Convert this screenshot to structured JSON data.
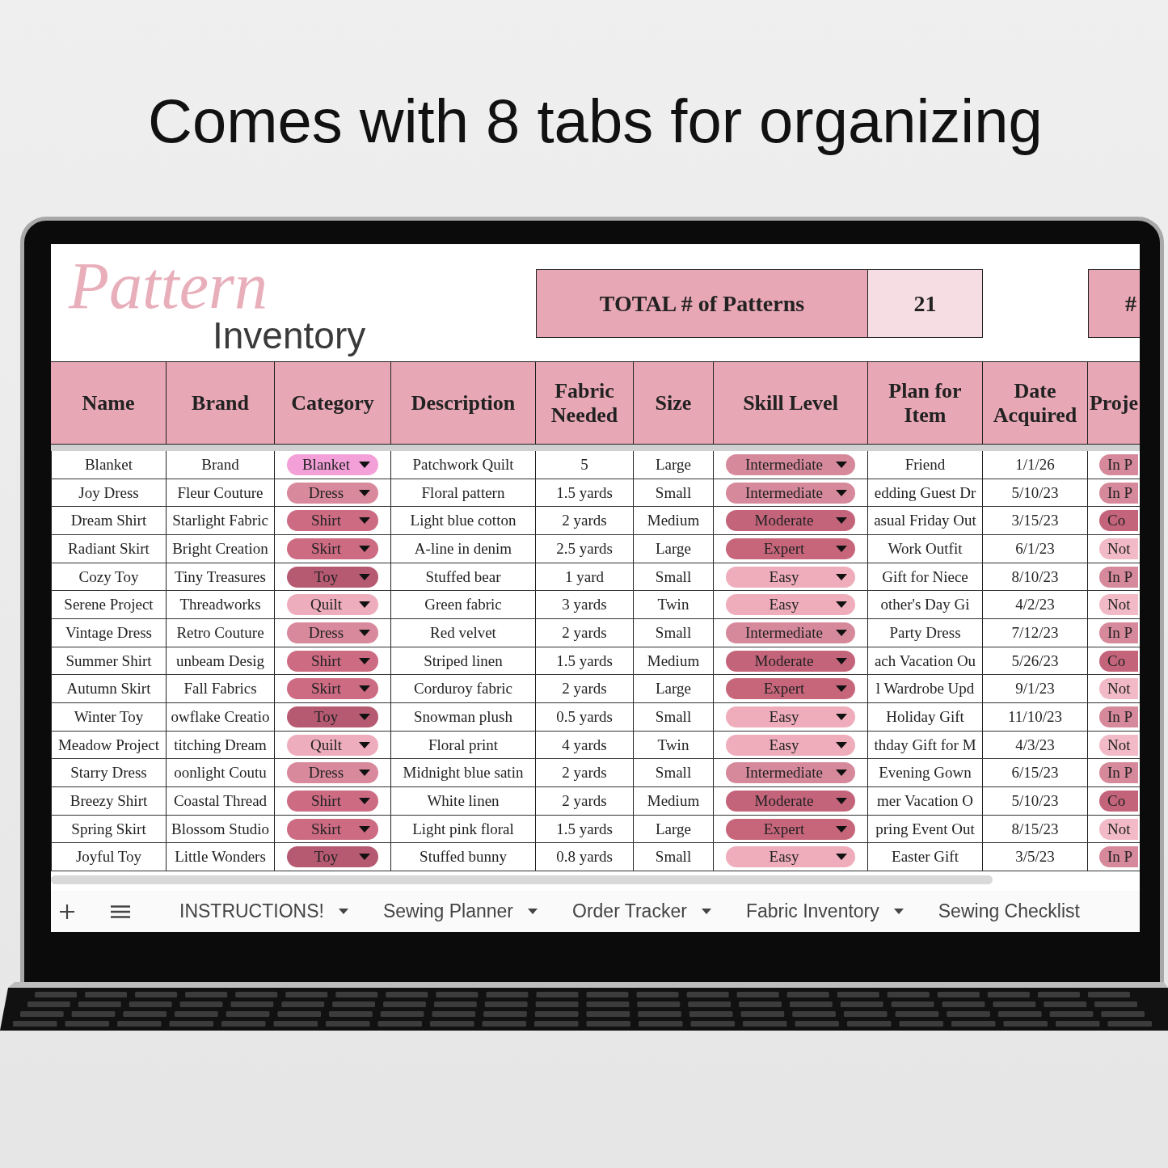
{
  "headline": "Comes with 8 tabs for organizing",
  "sheet": {
    "logo": {
      "script": "Pattern",
      "text": "Inventory"
    },
    "summary": [
      {
        "label": "TOTAL # of Patterns",
        "value": "21"
      },
      {
        "label": "#"
      }
    ],
    "columns": [
      {
        "label": "Name",
        "kind": "text"
      },
      {
        "label": "Brand",
        "kind": "text"
      },
      {
        "label": "Category",
        "kind": "dropdown"
      },
      {
        "label": "Description",
        "kind": "text"
      },
      {
        "label": "Fabric Needed",
        "kind": "text"
      },
      {
        "label": "Size",
        "kind": "text"
      },
      {
        "label": "Skill Level",
        "kind": "dropdown"
      },
      {
        "label": "Plan for Item",
        "kind": "text"
      },
      {
        "label": "Date Acquired",
        "kind": "text"
      },
      {
        "label": "Proje",
        "kind": "pill"
      }
    ],
    "rows": [
      {
        "cells": [
          "Blanket",
          "Brand",
          {
            "label": "Blanket",
            "color": "#f3a0d9"
          },
          "Patchwork Quilt",
          "5",
          "Large",
          {
            "label": "Intermediate",
            "color": "#d6899b"
          },
          "Friend",
          "1/1/26",
          {
            "label": "In P",
            "color": "#d6899b"
          }
        ]
      },
      {
        "cells": [
          "Joy Dress",
          "Fleur Couture",
          {
            "label": "Dress",
            "color": "#d8899b"
          },
          "Floral pattern",
          "1.5 yards",
          "Small",
          {
            "label": "Intermediate",
            "color": "#d6899b"
          },
          "edding Guest Dr",
          "5/10/23",
          {
            "label": "In P",
            "color": "#d6899b"
          }
        ]
      },
      {
        "cells": [
          "Dream Shirt",
          "Starlight Fabric",
          {
            "label": "Shirt",
            "color": "#cc6b82"
          },
          "Light blue cotton",
          "2 yards",
          "Medium",
          {
            "label": "Moderate",
            "color": "#c4647a"
          },
          "asual Friday Out",
          "3/15/23",
          {
            "label": "Co",
            "color": "#c4647a"
          }
        ]
      },
      {
        "cells": [
          "Radiant Skirt",
          "Bright Creation",
          {
            "label": "Skirt",
            "color": "#cc6b82"
          },
          "A-line in denim",
          "2.5 yards",
          "Large",
          {
            "label": "Expert",
            "color": "#c7667b"
          },
          "Work Outfit",
          "6/1/23",
          {
            "label": "Not",
            "color": "#f2bac6"
          }
        ]
      },
      {
        "cells": [
          "Cozy Toy",
          "Tiny Treasures",
          {
            "label": "Toy",
            "color": "#b65a71"
          },
          "Stuffed bear",
          "1 yard",
          "Small",
          {
            "label": "Easy",
            "color": "#efadbb"
          },
          "Gift for Niece",
          "8/10/23",
          {
            "label": "In P",
            "color": "#d6899b"
          }
        ]
      },
      {
        "cells": [
          "Serene Project",
          "Threadworks",
          {
            "label": "Quilt",
            "color": "#eeadbd"
          },
          "Green fabric",
          "3 yards",
          "Twin",
          {
            "label": "Easy",
            "color": "#efadbb"
          },
          "other's Day Gi",
          "4/2/23",
          {
            "label": "Not",
            "color": "#f2bac6"
          }
        ]
      },
      {
        "cells": [
          "Vintage Dress",
          "Retro Couture",
          {
            "label": "Dress",
            "color": "#d8899b"
          },
          "Red velvet",
          "2 yards",
          "Small",
          {
            "label": "Intermediate",
            "color": "#d6899b"
          },
          "Party Dress",
          "7/12/23",
          {
            "label": "In P",
            "color": "#d6899b"
          }
        ]
      },
      {
        "cells": [
          "Summer Shirt",
          "unbeam Desig",
          {
            "label": "Shirt",
            "color": "#cc6b82"
          },
          "Striped linen",
          "1.5 yards",
          "Medium",
          {
            "label": "Moderate",
            "color": "#c4647a"
          },
          "ach Vacation Ou",
          "5/26/23",
          {
            "label": "Co",
            "color": "#c4647a"
          }
        ]
      },
      {
        "cells": [
          "Autumn Skirt",
          "Fall Fabrics",
          {
            "label": "Skirt",
            "color": "#cc6b82"
          },
          "Corduroy fabric",
          "2 yards",
          "Large",
          {
            "label": "Expert",
            "color": "#c7667b"
          },
          "l Wardrobe Upd",
          "9/1/23",
          {
            "label": "Not",
            "color": "#f2bac6"
          }
        ]
      },
      {
        "cells": [
          "Winter Toy",
          "owflake Creatio",
          {
            "label": "Toy",
            "color": "#b65a71"
          },
          "Snowman plush",
          "0.5 yards",
          "Small",
          {
            "label": "Easy",
            "color": "#efadbb"
          },
          "Holiday Gift",
          "11/10/23",
          {
            "label": "In P",
            "color": "#d6899b"
          }
        ]
      },
      {
        "cells": [
          "Meadow Project",
          "titching Dream",
          {
            "label": "Quilt",
            "color": "#eeadbd"
          },
          "Floral print",
          "4 yards",
          "Twin",
          {
            "label": "Easy",
            "color": "#efadbb"
          },
          "thday Gift for M",
          "4/3/23",
          {
            "label": "Not",
            "color": "#f2bac6"
          }
        ]
      },
      {
        "cells": [
          "Starry Dress",
          "oonlight Coutu",
          {
            "label": "Dress",
            "color": "#d8899b"
          },
          "Midnight blue satin",
          "2 yards",
          "Small",
          {
            "label": "Intermediate",
            "color": "#d6899b"
          },
          "Evening Gown",
          "6/15/23",
          {
            "label": "In P",
            "color": "#d6899b"
          }
        ]
      },
      {
        "cells": [
          "Breezy Shirt",
          "Coastal Thread",
          {
            "label": "Shirt",
            "color": "#cc6b82"
          },
          "White linen",
          "2 yards",
          "Medium",
          {
            "label": "Moderate",
            "color": "#c4647a"
          },
          "mer Vacation O",
          "5/10/23",
          {
            "label": "Co",
            "color": "#c4647a"
          }
        ]
      },
      {
        "cells": [
          "Spring Skirt",
          "Blossom Studio",
          {
            "label": "Skirt",
            "color": "#cc6b82"
          },
          "Light pink floral",
          "1.5 yards",
          "Large",
          {
            "label": "Expert",
            "color": "#c7667b"
          },
          "pring Event Out",
          "8/15/23",
          {
            "label": "Not",
            "color": "#f2bac6"
          }
        ]
      },
      {
        "cells": [
          "Joyful Toy",
          "Little Wonders",
          {
            "label": "Toy",
            "color": "#b65a71"
          },
          "Stuffed bunny",
          "0.8 yards",
          "Small",
          {
            "label": "Easy",
            "color": "#efadbb"
          },
          "Easter Gift",
          "3/5/23",
          {
            "label": "In P",
            "color": "#d6899b"
          }
        ]
      }
    ],
    "tabs": [
      {
        "label": "INSTRUCTIONS!",
        "selected": false,
        "dropdown": true
      },
      {
        "label": "Sewing Planner",
        "selected": false,
        "dropdown": true
      },
      {
        "label": "Order Tracker",
        "selected": false,
        "dropdown": true
      },
      {
        "label": "Fabric Inventory",
        "selected": false,
        "dropdown": true
      },
      {
        "label": "Sewing Checklist",
        "selected": false,
        "dropdown": false
      }
    ]
  }
}
